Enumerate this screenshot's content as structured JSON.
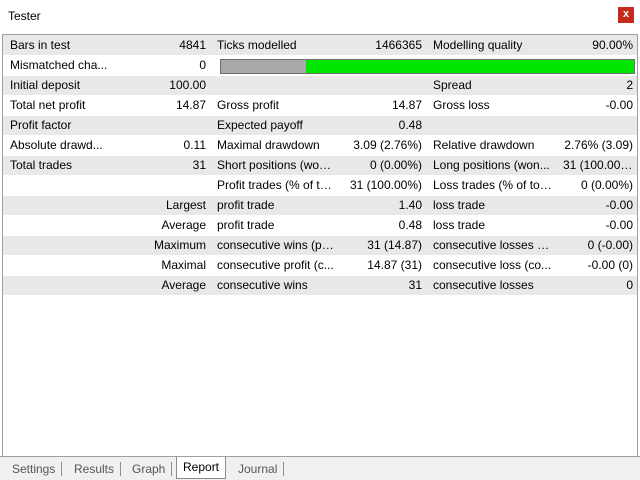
{
  "window": {
    "title": "Tester",
    "close_glyph": "x"
  },
  "quality_bar": {
    "grey_fraction": 0.205,
    "colors": {
      "grey": "#a8a8a8",
      "green": "#00e600"
    }
  },
  "rows": {
    "r1": {
      "a": "Bars in test",
      "av": "4841",
      "b": "Ticks modelled",
      "bv": "1466365",
      "c": "Modelling quality",
      "cv": "90.00%"
    },
    "r2": {
      "a": "Mismatched cha...",
      "av": "0"
    },
    "r3": {
      "a": "Initial deposit",
      "av": "100.00",
      "c": "Spread",
      "cv": "2"
    },
    "r4": {
      "a": "Total net profit",
      "av": "14.87",
      "b": "Gross profit",
      "bv": "14.87",
      "c": "Gross loss",
      "cv": "-0.00"
    },
    "r5": {
      "a": "Profit factor",
      "b": "Expected payoff",
      "bv": "0.48"
    },
    "r6": {
      "a": "Absolute drawd...",
      "av": "0.11",
      "b": "Maximal drawdown",
      "bv": "3.09 (2.76%)",
      "c": "Relative drawdown",
      "cv": "2.76% (3.09)"
    },
    "r7": {
      "a": "Total trades",
      "av": "31",
      "b": "Short positions (won...",
      "bv": "0 (0.00%)",
      "c": "Long positions (won...",
      "cv": "31 (100.00%)"
    },
    "r8": {
      "b": "Profit trades (% of to...",
      "bv": "31 (100.00%)",
      "c": "Loss trades (% of tot...",
      "cv": "0 (0.00%)"
    },
    "r9": {
      "a": "Largest",
      "b": "profit trade",
      "bv": "1.40",
      "c": "loss trade",
      "cv": "-0.00"
    },
    "r10": {
      "a": "Average",
      "b": "profit trade",
      "bv": "0.48",
      "c": "loss trade",
      "cv": "-0.00"
    },
    "r11": {
      "a": "Maximum",
      "b": "consecutive wins (pr...",
      "bv": "31 (14.87)",
      "c": "consecutive losses (l...",
      "cv": "0 (-0.00)"
    },
    "r12": {
      "a": "Maximal",
      "b": "consecutive profit (c...",
      "bv": "14.87 (31)",
      "c": "consecutive loss (co...",
      "cv": "-0.00 (0)"
    },
    "r13": {
      "a": "Average",
      "b": "consecutive wins",
      "bv": "31",
      "c": "consecutive losses",
      "cv": "0"
    }
  },
  "tabs": {
    "settings": "Settings",
    "results": "Results",
    "graph": "Graph",
    "report": "Report",
    "journal": "Journal"
  }
}
